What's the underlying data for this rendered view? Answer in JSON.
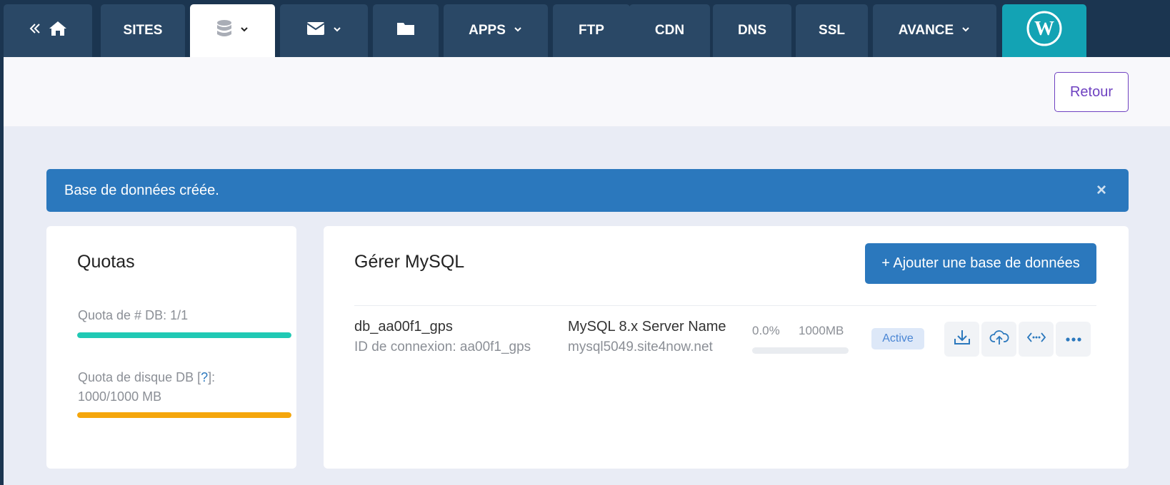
{
  "nav": {
    "tabs": [
      {
        "label": "",
        "icon": "home-icon"
      },
      {
        "label": "SITES"
      },
      {
        "label": "",
        "icon": "database-icon"
      },
      {
        "label": "",
        "icon": "mail-icon"
      },
      {
        "label": "",
        "icon": "folder-icon"
      },
      {
        "label": "APPS"
      },
      {
        "label": "FTP"
      },
      {
        "label": "CDN"
      },
      {
        "label": "DNS"
      },
      {
        "label": "SSL"
      },
      {
        "label": "AVANCE"
      },
      {
        "label": "",
        "icon": "wordpress-icon"
      }
    ],
    "active_tab": "database",
    "colors": {
      "bar": "#1b3550",
      "tab": "#2a4866",
      "wordpress": "#13a3b4"
    }
  },
  "header": {
    "back_label": "Retour"
  },
  "alert": {
    "message": "Base de données créée.",
    "close_symbol": "×"
  },
  "quotas": {
    "title": "Quotas",
    "db_quota_label": "Quota de # DB: 1/1",
    "db_quota_fraction": 1.0,
    "disk_quota_prefix": "Quota de disque DB [",
    "disk_quota_help": "?",
    "disk_quota_suffix": "]:",
    "disk_quota_value": "1000/1000 MB",
    "disk_quota_fraction": 1.0,
    "colors": {
      "db_bar": "#20c9b4",
      "disk_bar": "#f5a60b"
    }
  },
  "mysql": {
    "title": "Gérer MySQL",
    "add_button_label": "+ Ajouter une base de données",
    "databases": [
      {
        "name": "db_aa00f1_gps",
        "login_label": "ID de connexion: aa00f1_gps",
        "server_name": "MySQL 8.x Server Name",
        "server_host": "mysql5049.site4now.net",
        "usage_percent": "0.0%",
        "usage_fraction": 0.0,
        "size": "1000MB",
        "status": "Active",
        "actions": [
          "download-icon",
          "cloud-upload-icon",
          "connection-icon",
          "more-icon"
        ]
      }
    ]
  }
}
